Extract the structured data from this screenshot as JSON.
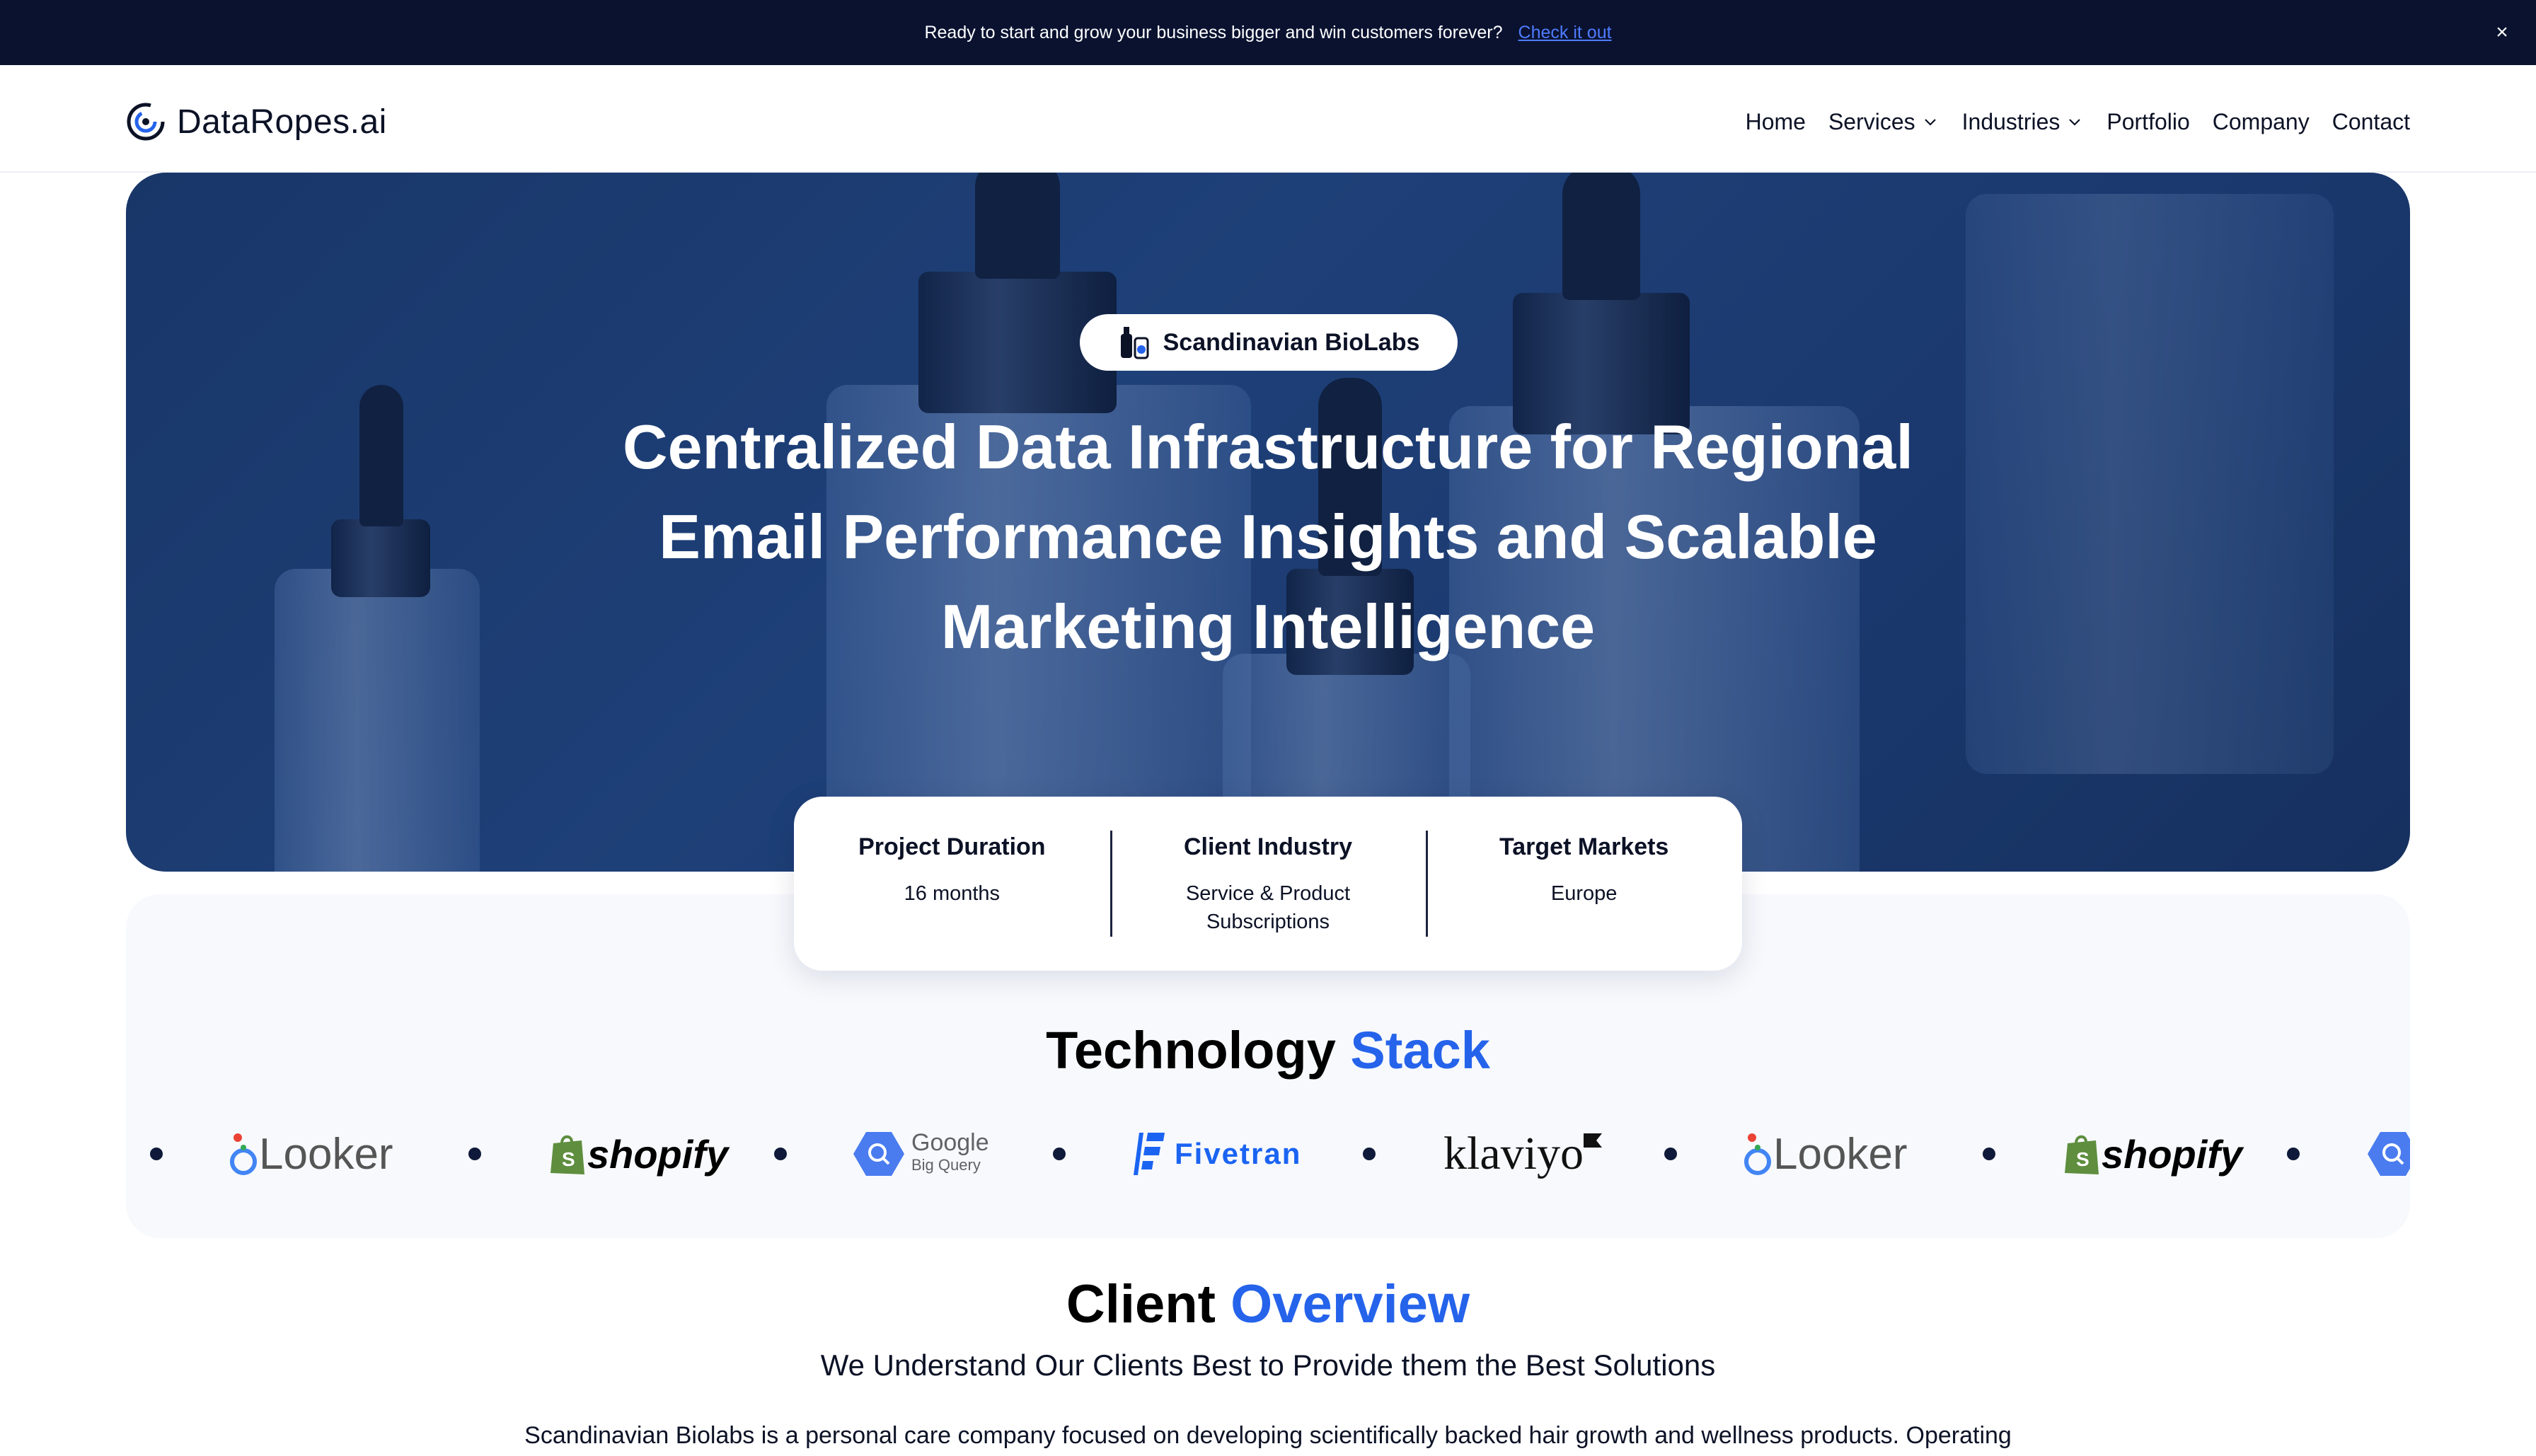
{
  "announcement": {
    "message": "Ready to start and grow your business bigger and win customers forever?",
    "cta": "Check it out",
    "close": "×"
  },
  "brand": {
    "name": "DataRopes.ai"
  },
  "nav": {
    "home": "Home",
    "services": "Services",
    "industries": "Industries",
    "portfolio": "Portfolio",
    "company": "Company",
    "contact": "Contact"
  },
  "hero": {
    "badge": "Scandinavian BioLabs",
    "title_lines": [
      "Centralized Data Infrastructure for Regional",
      "Email Performance Insights and Scalable",
      "Marketing Intelligence"
    ]
  },
  "project_info": [
    {
      "label": "Project Duration",
      "value": "16 months"
    },
    {
      "label": "Client Industry",
      "value_lines": [
        "Service & Product",
        "Subscriptions"
      ]
    },
    {
      "label": "Target Markets",
      "value": "Europe"
    }
  ],
  "tech_stack": {
    "title_main": "Technology",
    "title_accent": "Stack",
    "logos": [
      "Looker",
      "shopify",
      "Google Big Query",
      "Fivetran",
      "klaviyo",
      "Looker",
      "shopify",
      "Google Big Query"
    ],
    "bigquery_lines": [
      "Google",
      "Big Query"
    ]
  },
  "overview": {
    "title_main": "Client",
    "title_accent": "Overview",
    "subtitle": "We Understand Our Clients Best to Provide them the Best Solutions",
    "body": "Scandinavian Biolabs is a personal care company focused on developing scientifically backed hair growth and wellness products. Operating"
  },
  "colors": {
    "accent": "#2563eb",
    "topbar": "#0a1230",
    "hero": "#244a86"
  }
}
